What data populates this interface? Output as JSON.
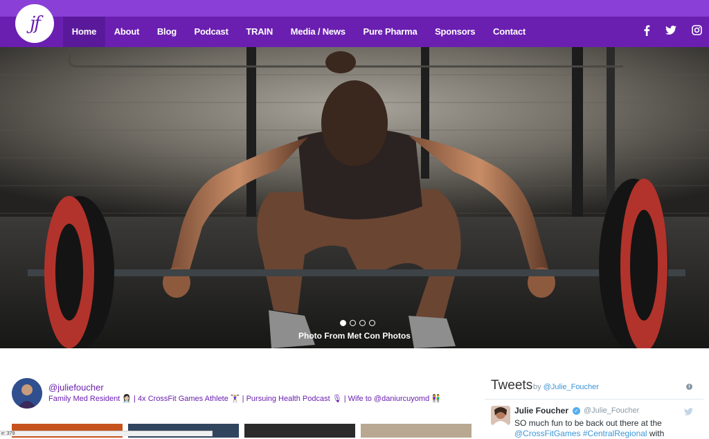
{
  "header": {
    "logo_text": "jf",
    "nav": [
      {
        "label": "Home",
        "active": true
      },
      {
        "label": "About"
      },
      {
        "label": "Blog"
      },
      {
        "label": "Podcast"
      },
      {
        "label": "TRAIN"
      },
      {
        "label": "Media / News"
      },
      {
        "label": "Pure Pharma"
      },
      {
        "label": "Sponsors"
      },
      {
        "label": "Contact"
      }
    ],
    "social": [
      "facebook-icon",
      "twitter-icon",
      "instagram-icon"
    ],
    "colors": {
      "top_strip": "#8a3fd6",
      "nav_bg": "#6a1fb0",
      "nav_active": "#5a199a"
    }
  },
  "hero": {
    "caption": "Photo From Met Con Photos",
    "slide_count": 4,
    "active_slide": 1
  },
  "instagram": {
    "handle": "@juliefoucher",
    "bio": "Family Med Resident 👩🏻‍⚕️ | 4x CrossFit Games Athlete 🏋🏼‍♀️ | Pursuing Health Podcast 🎙 | Wife to @daniurcuyomd 👫"
  },
  "tweets": {
    "title": "Tweets",
    "by_prefix": "by",
    "by_handle": "@Julie_Foucher",
    "tweet": {
      "name": "Julie Foucher",
      "handle": "@Julie_Foucher",
      "text": "SO much fun to be back out there at the",
      "link_text": "@CrossFitGames #CentralRegional",
      "text_after": " with"
    }
  },
  "status_bar": {
    "text": "e: 379"
  }
}
